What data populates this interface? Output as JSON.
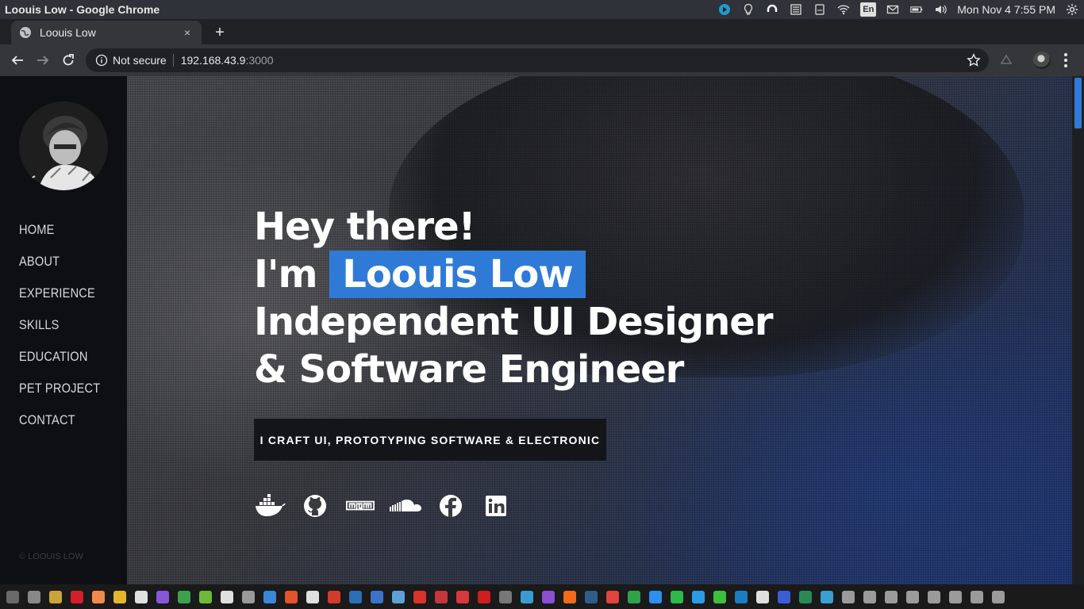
{
  "os": {
    "window_title": "Loouis Low - Google Chrome",
    "input_method": "En",
    "clock": "Mon Nov  4  7:55 PM"
  },
  "browser": {
    "tab_title": "Loouis Low",
    "tab_close": "×",
    "new_tab": "+",
    "security_label": "Not secure",
    "url_host": "192.168.43.9",
    "url_port": ":3000"
  },
  "sidebar": {
    "nav": [
      "HOME",
      "ABOUT",
      "EXPERIENCE",
      "SKILLS",
      "EDUCATION",
      "PET PROJECT",
      "CONTACT"
    ],
    "footer": "© LOOUIS LOW"
  },
  "hero": {
    "line1": "Hey there!",
    "line2_prefix": "I'm ",
    "name": "Loouis Low",
    "line3": "Independent UI Designer",
    "line4": "& Software Engineer",
    "cta": "I CRAFT UI, PROTOTYPING SOFTWARE & ELECTRONIC",
    "socials": [
      "docker-icon",
      "github-icon",
      "npm-icon",
      "soundcloud-icon",
      "facebook-icon",
      "linkedin-icon"
    ]
  },
  "colors": {
    "accent": "#2f7ad6",
    "sidebar_bg": "#0d0f13",
    "cta_bg": "#131518"
  },
  "dock": {
    "icon_colors": [
      "#6a6a6a",
      "#888888",
      "#c9a43a",
      "#d1202b",
      "#f08a4b",
      "#e5b52b",
      "#e0e0e0",
      "#8a56d9",
      "#3ca04c",
      "#6fb83a",
      "#e0e0e0",
      "#9a9a9a",
      "#3b86d6",
      "#e2542a",
      "#e0e0e0",
      "#d33b2b",
      "#2c6fb5",
      "#3a73c9",
      "#5da0d8",
      "#d9342b",
      "#c3363a",
      "#d8373e",
      "#cc1f1f",
      "#777777",
      "#3b9bd1",
      "#8a4fd3",
      "#f26a1b",
      "#2d5d8a",
      "#e0443e",
      "#2ea34a",
      "#2e8ff0",
      "#2fb84c",
      "#2b9be6",
      "#3dbf3d",
      "#1a7dc0",
      "#e0e0e0",
      "#3b5ed6",
      "#2a8a56",
      "#3aa0d0",
      "#9b9b9b",
      "#9b9b9b",
      "#9b9b9b",
      "#9b9b9b",
      "#9b9b9b",
      "#9b9b9b",
      "#9b9b9b",
      "#9b9b9b"
    ]
  }
}
